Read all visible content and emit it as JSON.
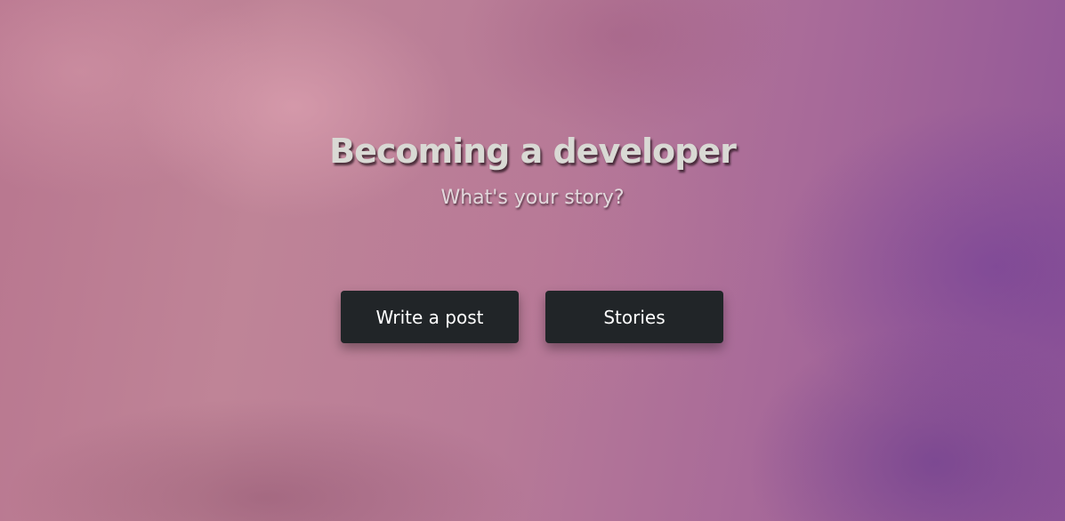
{
  "hero": {
    "title": "Becoming a developer",
    "subtitle": "What's your story?"
  },
  "actions": {
    "write_label": "Write a post",
    "stories_label": "Stories"
  },
  "colors": {
    "button_bg": "#212528",
    "button_text": "#ffffff",
    "title_text": "#d9d9d4"
  }
}
